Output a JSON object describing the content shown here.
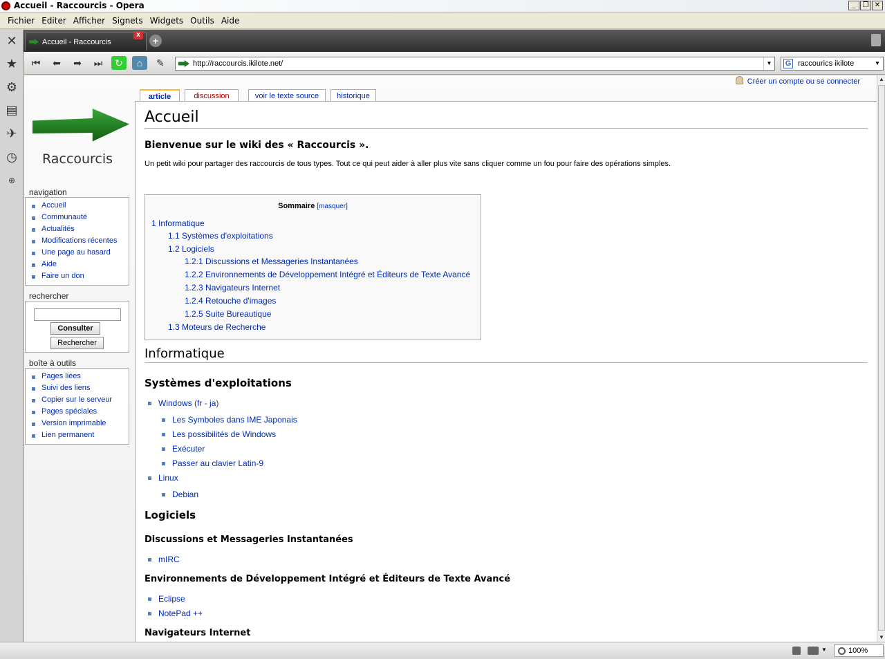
{
  "window": {
    "title": "Accueil - Raccourcis - Opera"
  },
  "menu": {
    "items": [
      "Fichier",
      "Editer",
      "Afficher",
      "Signets",
      "Widgets",
      "Outils",
      "Aide"
    ]
  },
  "tab": {
    "label": "Accueil - Raccourcis",
    "close": "x"
  },
  "address": {
    "url": "http://raccourcis.ikilote.net/",
    "search": "raccourics ikilote",
    "search_engine": "G"
  },
  "site": {
    "logo_text": "Raccourcis"
  },
  "sidebar": {
    "navigation_title": "navigation",
    "navigation": [
      "Accueil",
      "Communauté",
      "Actualités",
      "Modifications récentes",
      "Une page au hasard",
      "Aide",
      "Faire un don"
    ],
    "search_title": "rechercher",
    "search_value": "",
    "consult_button": "Consulter",
    "search_button": "Rechercher",
    "toolbox_title": "boîte à outils",
    "toolbox": [
      "Pages liées",
      "Suivi des liens",
      "Copier sur le serveur",
      "Pages spéciales",
      "Version imprimable",
      "Lien permanent"
    ]
  },
  "page_tabs": [
    "article",
    "discussion",
    "voir le texte source",
    "historique"
  ],
  "user_link": "Créer un compte ou se connecter",
  "article": {
    "title": "Accueil",
    "welcome": "Bienvenue sur le wiki des « Raccourcis ».",
    "intro": "Un petit wiki pour partager des raccourcis de tous types. Tout ce qui peut aider à aller plus vite sans cliquer comme un fou pour faire des opérations simples.",
    "toc_title": "Sommaire",
    "toc_hide": "[masquer]",
    "toc": [
      "1 Informatique",
      "1.1 Systèmes d'exploitations",
      "1.2 Logiciels",
      "1.2.1 Discussions et Messageries Instantanées",
      "1.2.2 Environnements de Développement Intégré et Éditeurs de Texte Avancé",
      "1.2.3 Navigateurs Internet",
      "1.2.4 Retouche d'images",
      "1.2.5 Suite Bureautique",
      "1.3 Moteurs de Recherche"
    ],
    "h_informatique": "Informatique",
    "h_systemes": "Systèmes d'exploitations",
    "windows": "Windows",
    "windows_paren_open": "(",
    "windows_fr": "fr",
    "windows_sep": " - ",
    "windows_ja": "ja",
    "windows_paren_close": ")",
    "windows_items": [
      "Les Symboles dans IME Japonais",
      "Les possibilités de Windows",
      "Exécuter",
      "Passer au clavier Latin-9"
    ],
    "linux": "Linux",
    "linux_items": [
      "Debian"
    ],
    "h_logiciels": "Logiciels",
    "h_discussions": "Discussions et Messageries Instantanées",
    "discussions_items": [
      "mIRC"
    ],
    "h_environnements": "Environnements de Développement Intégré et Éditeurs de Texte Avancé",
    "environnements_items": [
      "Eclipse",
      "NotePad ++"
    ],
    "h_navigateurs": "Navigateurs Internet"
  },
  "status": {
    "zoom": "100%"
  }
}
